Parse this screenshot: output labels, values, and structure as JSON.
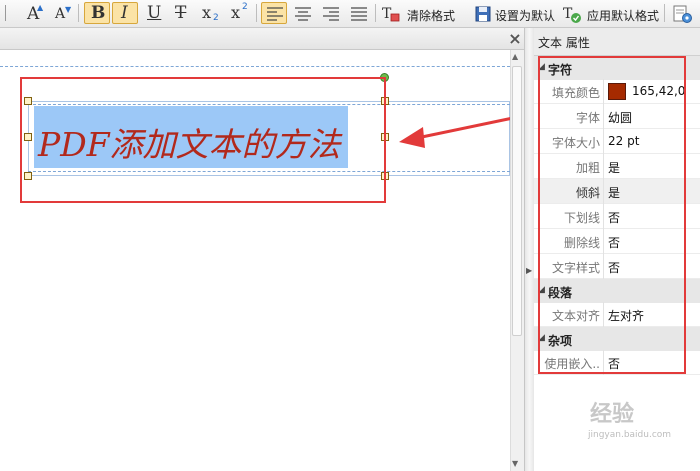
{
  "toolbar": {
    "bold_label": "B",
    "italic_label": "I",
    "underline_label": "U",
    "strike_label": "T",
    "subscript_label": "x",
    "subscript_mark": "2",
    "superscript_label": "x",
    "superscript_mark": "2",
    "clear_format_label": "清除格式",
    "set_default_label": "设置为默认",
    "apply_default_label": "应用默认格式",
    "icons": [
      "font-grow-icon",
      "font-shrink-icon",
      "align-left-icon",
      "align-center-icon",
      "align-right-icon",
      "align-justify-icon",
      "eraser-icon",
      "save-icon",
      "format-check-icon",
      "settings-icon"
    ]
  },
  "document": {
    "close_label": "×",
    "text_content": "PDF添加文本的方法",
    "text_color": "#b2291c",
    "highlight_color": "#9cc8f7"
  },
  "panel": {
    "title": "文本 属性",
    "categories": [
      {
        "name": "字符",
        "rows": [
          {
            "label": "填充颜色",
            "value": "165,42,0",
            "swatch": "#a52a00"
          },
          {
            "label": "字体",
            "value": "幼圆"
          },
          {
            "label": "字体大小",
            "value": "22 pt"
          },
          {
            "label": "加粗",
            "value": "是"
          },
          {
            "label": "倾斜",
            "value": "是"
          },
          {
            "label": "下划线",
            "value": "否"
          },
          {
            "label": "删除线",
            "value": "否"
          },
          {
            "label": "文字样式",
            "value": "否"
          }
        ]
      },
      {
        "name": "段落",
        "rows": [
          {
            "label": "文本对齐",
            "value": "左对齐"
          }
        ]
      },
      {
        "name": "杂项",
        "rows": [
          {
            "label": "使用嵌入..",
            "value": "否"
          }
        ]
      }
    ]
  },
  "watermark": {
    "text": "经验",
    "url": "jingyan.baidu.com"
  },
  "annotation_color": "#e23a3a"
}
